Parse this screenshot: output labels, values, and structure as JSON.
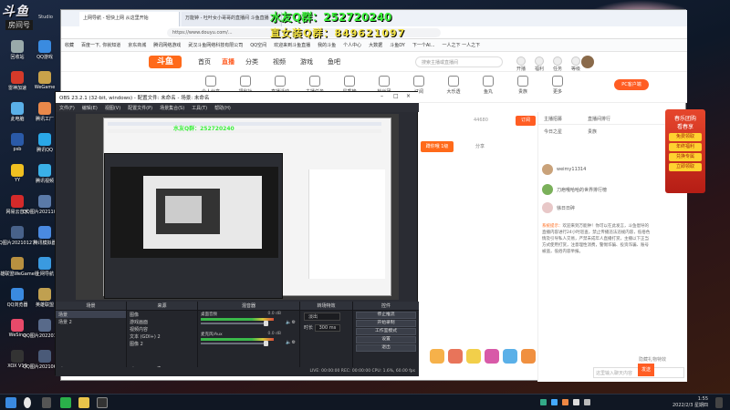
{
  "desktop": {
    "logo_main": "斗鱼",
    "logo_sub": "房间号",
    "studio": "Studio",
    "icons": [
      {
        "label": "回收站",
        "color": "#9aa"
      },
      {
        "label": "QQ游戏",
        "color": "#3a8be0"
      },
      {
        "label": "雷神加速",
        "color": "#d43a2a"
      },
      {
        "label": "WeGame",
        "color": "#c9a24a"
      },
      {
        "label": "此电脑",
        "color": "#5ab0e8"
      },
      {
        "label": "腾讯工厂",
        "color": "#e8884a"
      },
      {
        "label": "psb",
        "color": "#2a5aa8"
      },
      {
        "label": "腾讯QQ",
        "color": "#2aa8e8"
      },
      {
        "label": "YY",
        "color": "#f0c020"
      },
      {
        "label": "腾讯视频",
        "color": "#3ab0e8"
      },
      {
        "label": "网易云音乐",
        "color": "#d42a2a"
      },
      {
        "label": "QQ图片20211004...",
        "color": "#5a7aa8"
      },
      {
        "label": "QQ图片20210127...",
        "color": "#48628a"
      },
      {
        "label": "腾讯模拟器",
        "color": "#4a8ae0"
      },
      {
        "label": "英雄联盟WeGame版",
        "color": "#b89040"
      },
      {
        "label": "上网导航",
        "color": "#3a9ae0"
      },
      {
        "label": "QQ浏览器",
        "color": "#3a8ae0"
      },
      {
        "label": "英雄联盟",
        "color": "#c0a050"
      },
      {
        "label": "WeSing",
        "color": "#e84a6a"
      },
      {
        "label": "QQ图片20220129...",
        "color": "#586a8a"
      },
      {
        "label": "XOX V10",
        "color": "#333"
      },
      {
        "label": "QQ图片20210601...",
        "color": "#4a5a78"
      }
    ]
  },
  "stream_overlay": {
    "qq_group": "水友Q群：252720240",
    "qq_group2": "直女装Q群：849621097"
  },
  "browser": {
    "tabs": [
      "上网导航 - 轻快上网 从这里开始",
      "万能钟 - 吐叶女小哥哥的直播间 斗鱼直播"
    ],
    "address": "https://www.douyu.com/...",
    "bookmarks": [
      "收藏",
      "百度一下, 你就知道",
      "京东商城",
      "腾讯网络游戏",
      "武汉斗鱼网络科技有限公司",
      "QQ空间",
      "欢迎来到斗鱼直播",
      "我的斗鱼",
      "个人中心",
      "大数据",
      "斗鱼DY",
      "下一个AI...",
      "一人之下 一人之下"
    ],
    "site": {
      "logo": "斗鱼",
      "nav": [
        "首页",
        "直播",
        "分类",
        "视频",
        "游戏",
        "鱼吧"
      ],
      "search_placeholder": "搜索主播或直播间",
      "head_icons": [
        "开播",
        "福利",
        "任务",
        "等级"
      ],
      "categories": [
        "热门",
        "英雄联盟",
        "王者荣耀",
        "和平精英",
        "户外",
        "颜值",
        "绝地求生",
        "主机游戏",
        "二次元",
        "星秀",
        "DNF",
        "原神",
        "CF",
        "穿越火线",
        "鱼塘",
        "音乐",
        "热门游戏",
        "时尚",
        "美食"
      ],
      "cat_labels": [
        "个人分享",
        "福利社",
        "直播活动",
        "主播任务",
        "星秀榜",
        "粉丝团",
        "订阅",
        "大乐透",
        "鱼丸",
        "贵族",
        "更多"
      ],
      "pc_button": "PC客户端",
      "live_tag": "蹲你哦 1级",
      "follow_label": "订阅",
      "follow_count": "44680",
      "share": "分享",
      "chat": {
        "tabs": [
          "主播招募",
          "直播间排行",
          "今日之星",
          "贵族"
        ],
        "users": [
          "weimy11314",
          "刀疤哦哈哈的世界排行榜",
          "徐日日碎"
        ],
        "notice_title": "系统提示：",
        "notice": "欢迎来到万能钟！你可以在此发言，斗鱼倡导的直播内容进行24小时巡查，禁止传播违法违规内容，低俗色情及引导私人交易，严禁未成年人直播打赏，主播以下正当方式使用打赏，注意理性消费，警惕诈骗、投资诈骗、账号被盗，低俗内容举报。",
        "input_placeholder": "这里输入聊天内容",
        "send": "发送",
        "hide_effects": "隐藏礼物特效"
      },
      "ad": {
        "line1": "春乐团购",
        "line2": "看春享",
        "badge1": "免费领取",
        "badge2": "年终福利",
        "badge3": "兑换专属",
        "cta": "立即领取"
      }
    }
  },
  "obs": {
    "title": "OBS 23.2.1 (32-bit, windows) - 配置文件: 未命名 - 场景: 未命名",
    "menu": [
      "文件(F)",
      "编辑(E)",
      "视图(V)",
      "配置文件(P)",
      "场景集合(S)",
      "工具(T)",
      "帮助(H)"
    ],
    "docks": {
      "scenes": {
        "header": "场景",
        "items": [
          "场景",
          "场景 2"
        ]
      },
      "sources": {
        "header": "来源",
        "items": [
          "图像",
          "游戏画面",
          "视频内容",
          "文本 (GDI+) 2",
          "图像 2"
        ]
      },
      "mixer": {
        "header": "混音器",
        "rows": [
          {
            "name": "桌面音频",
            "db": "0.0 dB"
          },
          {
            "name": "麦克风/Aux",
            "db": "0.0 dB"
          }
        ]
      },
      "transitions": {
        "header": "转场特效",
        "type": "淡出",
        "duration_label": "时长",
        "duration": "300 ms"
      },
      "controls": {
        "header": "控件",
        "buttons": [
          "停止推流",
          "开始录制",
          "工作室模式",
          "设置",
          "退出"
        ]
      }
    },
    "status": "LIVE: 00:00:00   REC: 00:00:00   CPU: 1.6%, 60.00 fps"
  },
  "taskbar": {
    "time": "1:55",
    "date": "2022/2/3 星期四"
  }
}
